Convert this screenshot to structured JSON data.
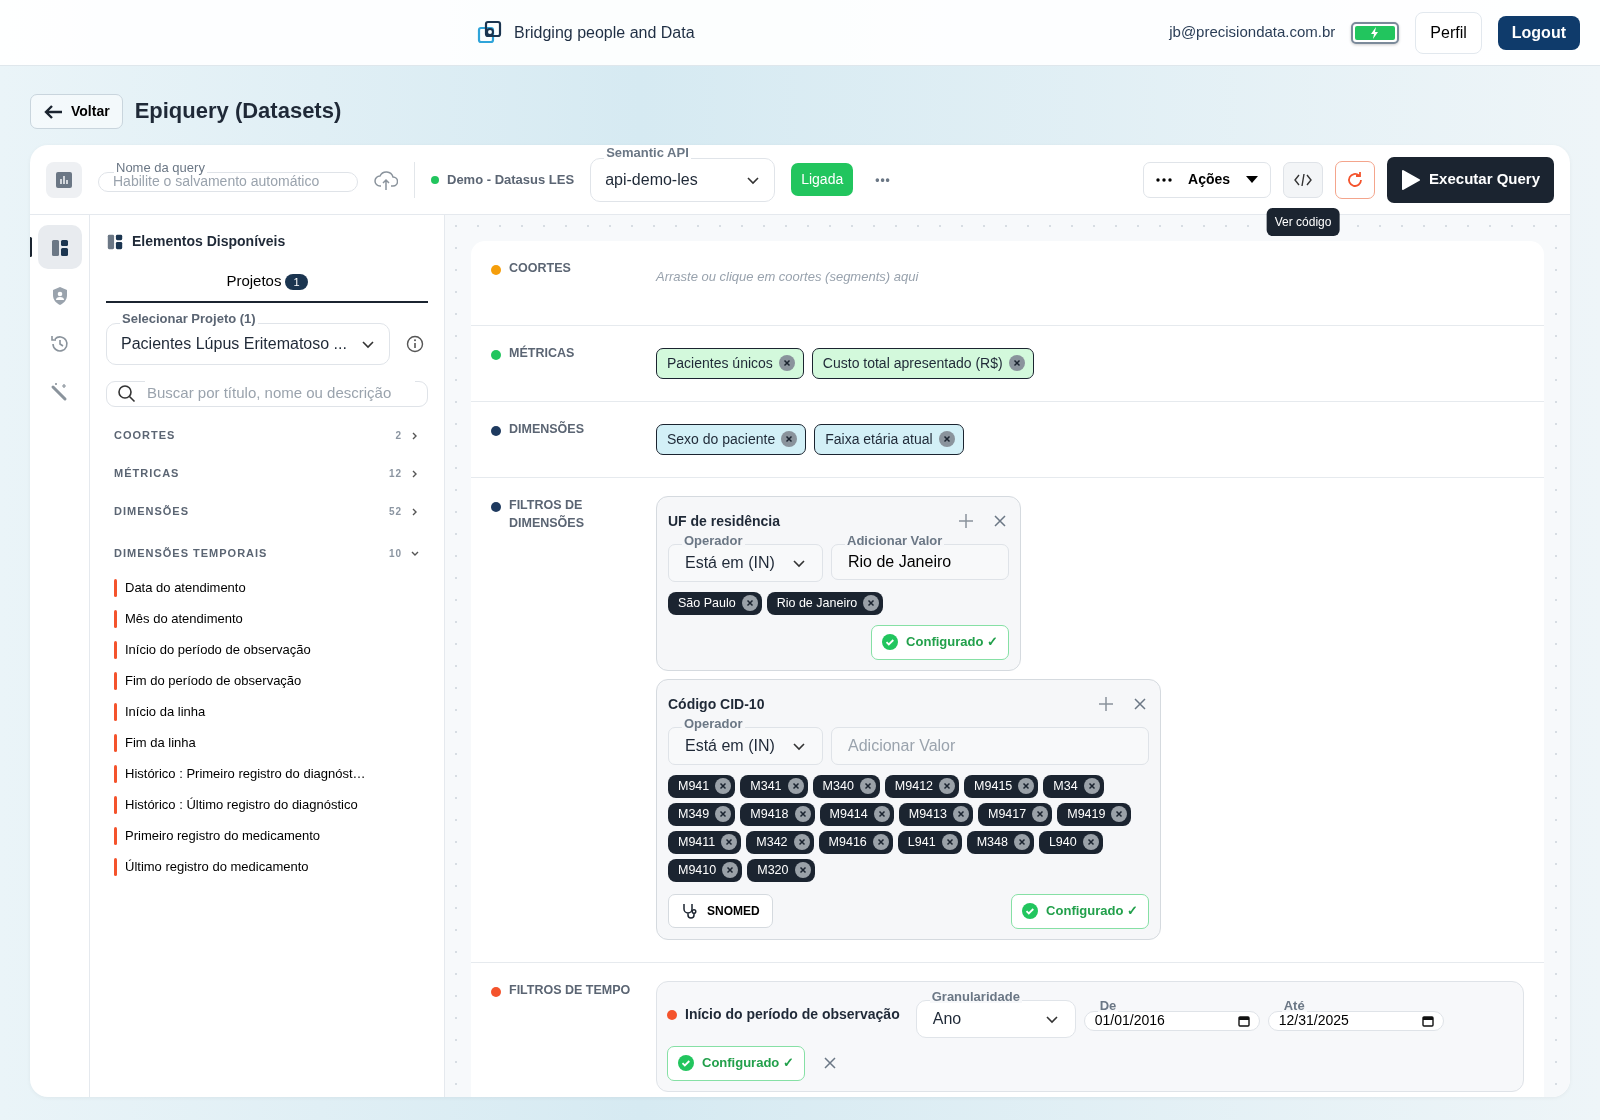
{
  "header": {
    "tagline": "Bridging people and Data",
    "email": "jb@precisiondata.com.br",
    "profile_button": "Perfil",
    "logout_button": "Logout"
  },
  "page": {
    "back_button": "Voltar",
    "title": "Epiquery (Datasets)"
  },
  "toolbar": {
    "query_name": {
      "label": "Nome da query",
      "placeholder": "Habilite o salvamento automático"
    },
    "dataset": {
      "label": "Demo - Datasus LES",
      "color": "#22c55e"
    },
    "semantic_api": {
      "label": "Semantic API",
      "value": "api-demo-les"
    },
    "status_badge": "Ligada",
    "more": "•••",
    "actions_button": "Ações",
    "tooltip": "Ver código",
    "run_button": "Executar Query"
  },
  "rail": [
    {
      "kind": "layout",
      "selected": true
    },
    {
      "kind": "shield",
      "selected": false
    },
    {
      "kind": "history",
      "selected": false
    },
    {
      "kind": "wand",
      "selected": false
    }
  ],
  "panel": {
    "title": "Elementos Disponíveis",
    "tab": {
      "label": "Projetos",
      "count": "1",
      "selected": true
    },
    "project_select": {
      "label": "Selecionar Projeto (1)",
      "value": "Pacientes Lúpus Eritematoso ..."
    },
    "search": {
      "placeholder": "Buscar por título, nome ou descrição"
    },
    "categories": [
      {
        "label": "COORTES",
        "count": "2",
        "expanded": false
      },
      {
        "label": "MÉTRICAS",
        "count": "12",
        "expanded": false
      },
      {
        "label": "DIMENSÕES",
        "count": "52",
        "expanded": false
      },
      {
        "label": "DIMENSÕES TEMPORAIS",
        "count": "10",
        "expanded": true,
        "items": [
          "Data do atendimento",
          "Mês do atendimento",
          "Início do período de observação",
          "Fim do período de observação",
          "Início da linha",
          "Fim da linha",
          "Histórico : Primeiro registro do diagnóst…",
          "Histórico : Último registro do diagnóstico",
          "Primeiro registro do medicamento",
          "Último registro do medicamento"
        ]
      }
    ]
  },
  "sections": [
    {
      "kind": "empty",
      "label": "COORTES",
      "color": "#f59e0b",
      "hint": "Arraste ou clique em coortes (segments) aqui"
    },
    {
      "kind": "metric",
      "label": "MÉTRICAS",
      "color": "#22c55e",
      "chips": [
        "Pacientes únicos",
        "Custo total apresentado (R$)"
      ]
    },
    {
      "kind": "dimension",
      "label": "DIMENSÕES",
      "color": "#1e3a5f",
      "chips": [
        "Sexo do paciente",
        "Faixa etária atual"
      ]
    },
    {
      "kind": "filters",
      "label": "FILTROS DE DIMENSÕES",
      "color": "#1e3a5f",
      "filters": [
        {
          "name": "UF de residência",
          "operator": {
            "label": "Operador",
            "value": "Está em (IN)"
          },
          "value_field": {
            "label": "Adicionar Valor",
            "value": "Rio de Janeiro"
          },
          "values": [
            "São Paulo",
            "Rio de Janeiro"
          ],
          "status": "Configurado ✓"
        },
        {
          "name": "Código CID-10",
          "operator": {
            "label": "Operador",
            "value": "Está em (IN)"
          },
          "value_field": {
            "placeholder": "Adicionar Valor"
          },
          "values": [
            "M941",
            "M341",
            "M340",
            "M9412",
            "M9415",
            "M34",
            "M349",
            "M9418",
            "M9414",
            "M9413",
            "M9417",
            "M9419",
            "M9411",
            "M342",
            "M9416",
            "L941",
            "M348",
            "L940",
            "M9410",
            "M320"
          ],
          "extra_button": "SNOMED",
          "status": "Configurado ✓"
        }
      ]
    },
    {
      "kind": "time",
      "label": "FILTROS DE TEMPO",
      "color": "#f4532c",
      "time_filter": {
        "color": "#f4532c",
        "name": "Início do período de observação",
        "granularity": {
          "label": "Granularidade",
          "value": "Ano"
        },
        "from": {
          "label": "De",
          "value": "01/01/2016"
        },
        "to": {
          "label": "Até",
          "value": "12/31/2025"
        },
        "status": "Configurado ✓"
      }
    }
  ]
}
